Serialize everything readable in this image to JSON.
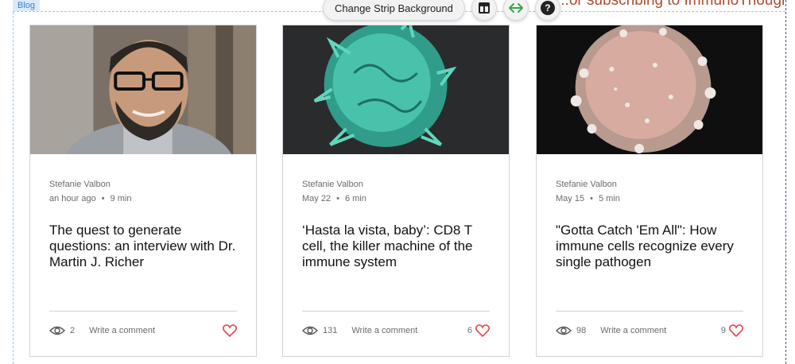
{
  "editor": {
    "blog_tag": "Blog",
    "change_background_label": "Change Strip Background",
    "header_scroll_text": "...or subscribing to ImmunoThoughts!",
    "help_label": "?"
  },
  "posts": [
    {
      "author": "Stefanie Valbon",
      "date": "an hour ago",
      "read_time": "9 min",
      "title": "The quest to generate questions: an interview with Dr. Martin J. Richer",
      "views": "2",
      "comment_label": "Write a comment",
      "likes": ""
    },
    {
      "author": "Stefanie Valbon",
      "date": "May 22",
      "read_time": "6 min",
      "title": "‘Hasta la vista, baby’: CD8 T cell, the killer machine of the immune system",
      "views": "131",
      "comment_label": "Write a comment",
      "likes": "6"
    },
    {
      "author": "Stefanie Valbon",
      "date": "May 15",
      "read_time": "5 min",
      "title": "\"Gotta Catch 'Em All\": How immune cells recognize every single pathogen",
      "views": "98",
      "comment_label": "Write a comment",
      "likes": "9"
    }
  ],
  "colors": {
    "heart": "#e0474c",
    "title": "#111111",
    "meta": "#6b6b6b",
    "accent_green": "#3aa64a"
  },
  "icons": {
    "views": "eye-icon",
    "likes": "heart-icon",
    "layout": "layout-icon",
    "stretch": "stretch-arrows-icon",
    "help": "help-icon"
  }
}
